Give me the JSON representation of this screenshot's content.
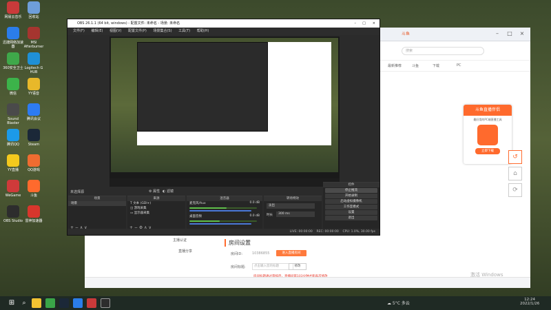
{
  "desktop_icons": [
    {
      "label": "网易云音乐",
      "color": "#c93a3a"
    },
    {
      "label": "回收站",
      "color": "#6e9ed9"
    },
    {
      "label": "迅捷网络加速器",
      "color": "#2b7de9"
    },
    {
      "label": "MSI Afterburner",
      "color": "#a5352f"
    },
    {
      "label": "360安全卫士",
      "color": "#3fa84a"
    },
    {
      "label": "Logitech G HUB",
      "color": "#1f90d6"
    },
    {
      "label": "微信",
      "color": "#3cb34a"
    },
    {
      "label": "YY语音",
      "color": "#e8b82a"
    },
    {
      "label": "Sound Blaster",
      "color": "#4a4a4a"
    },
    {
      "label": "腾讯会议",
      "color": "#2d7bf2"
    },
    {
      "label": "腾讯QQ",
      "color": "#1c9ae8"
    },
    {
      "label": "Steam",
      "color": "#1b2838"
    },
    {
      "label": "YY直播",
      "color": "#f3c91d"
    },
    {
      "label": "QQ游戏",
      "color": "#ef6c30"
    },
    {
      "label": "WeGame",
      "color": "#cf3a3a"
    },
    {
      "label": "斗鱼",
      "color": "#ff6a2d"
    },
    {
      "label": "OBS Studio",
      "color": "#2d2d2d"
    },
    {
      "label": "雷神加速器",
      "color": "#d8362c"
    }
  ],
  "obs": {
    "title": "OBS 26.1.1 (64 bit, windows) - 配置文件: 未命名 - 场景: 未命名",
    "menu": [
      "文件(F)",
      "编辑(E)",
      "视图(V)",
      "配置文件(P)",
      "场景集合(S)",
      "工具(T)",
      "帮助(H)"
    ],
    "preview_label": "未选择源",
    "preview_buttons": [
      "属性",
      "滤镜"
    ],
    "docks": {
      "scenes": {
        "header": "场景",
        "items": [
          "场景"
        ]
      },
      "sources": {
        "header": "来源",
        "items": [
          "文本 (GDI+)",
          "游戏采集",
          "显示器采集"
        ]
      },
      "mixer": {
        "header": "混音器",
        "tracks": [
          {
            "name": "麦克风/Aux",
            "db": "0.0 dB",
            "level": 0.55
          },
          {
            "name": "桌面音频",
            "db": "0.0 dB",
            "level": 0.45
          }
        ]
      },
      "transitions": {
        "header": "转场特效",
        "type": "淡出",
        "duration_label": "时长",
        "duration": "300 ms"
      },
      "controls": {
        "header": "控件",
        "buttons": [
          "停止推流",
          "开始录制",
          "启动虚拟摄像机",
          "工作室模式",
          "设置",
          "退出"
        ]
      }
    },
    "status": {
      "live": "LIVE: 00:00:00",
      "rec": "REC: 00:00:00",
      "cpu": "CPU: 1.0%, 30.00 fps"
    }
  },
  "browser": {
    "tab_label": "斗鱼",
    "search_placeholder": "搜索",
    "bookmarks": [
      "最新推荐",
      "斗鱼",
      "下载",
      "PC"
    ],
    "sidebar": [
      "主播认证",
      "直播分享"
    ],
    "room": {
      "heading": "房间设置",
      "id_label": "房间ID:",
      "id_value": "10386855",
      "id_button": "进入直播房间",
      "name_label": "房间标题:",
      "name_value": "点击输入您的标题",
      "name_button": "修改",
      "notice": "房间标题通过审核后，直播间第103分钟才能再次修改"
    },
    "ad": {
      "title": "斗鱼直播伴侣",
      "subtitle": "最好用的PC端直播工具",
      "cta": "立即下载"
    }
  },
  "watermark": "激活 Windows",
  "taskbar": {
    "weather": "5°C 多云",
    "time": "12:24",
    "date": "2022/1/26"
  }
}
